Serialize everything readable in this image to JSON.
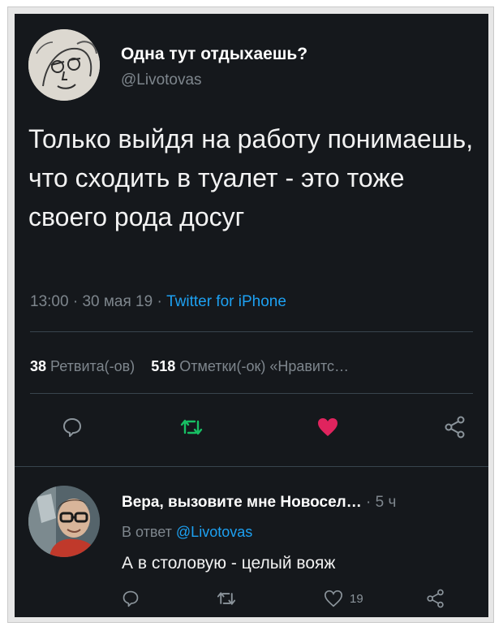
{
  "tweet": {
    "author_name": "Одна тут отдыхаешь?",
    "author_handle": "@Livotovas",
    "text": "Только выйдя на работу понимаешь, что сходить в туалет - это тоже своего рода досуг",
    "time": "13:00",
    "date": "30 мая 19",
    "separator": "·",
    "source": "Twitter for iPhone",
    "retweets_count": "38",
    "retweets_label": "Ретвита(-ов)",
    "likes_count": "518",
    "likes_label": "Отметки(-ок) «Нравитс…"
  },
  "actions": {
    "reply_icon": "reply-icon",
    "retweet_icon": "retweet-icon",
    "like_icon": "heart-icon",
    "share_icon": "share-icon"
  },
  "reply": {
    "author_name": "Вера, вызовите мне Новосел…",
    "separator": "·",
    "age": "5 ч",
    "in_reply_to_prefix": "В ответ",
    "in_reply_to_handle": "@Livotovas",
    "text": "А в столовую - целый вояж",
    "like_count": "19"
  },
  "colors": {
    "background": "#15181c",
    "accent": "#1da1f2",
    "liked": "#e0245e",
    "retweet": "#17bf63",
    "muted": "#7e868d"
  }
}
